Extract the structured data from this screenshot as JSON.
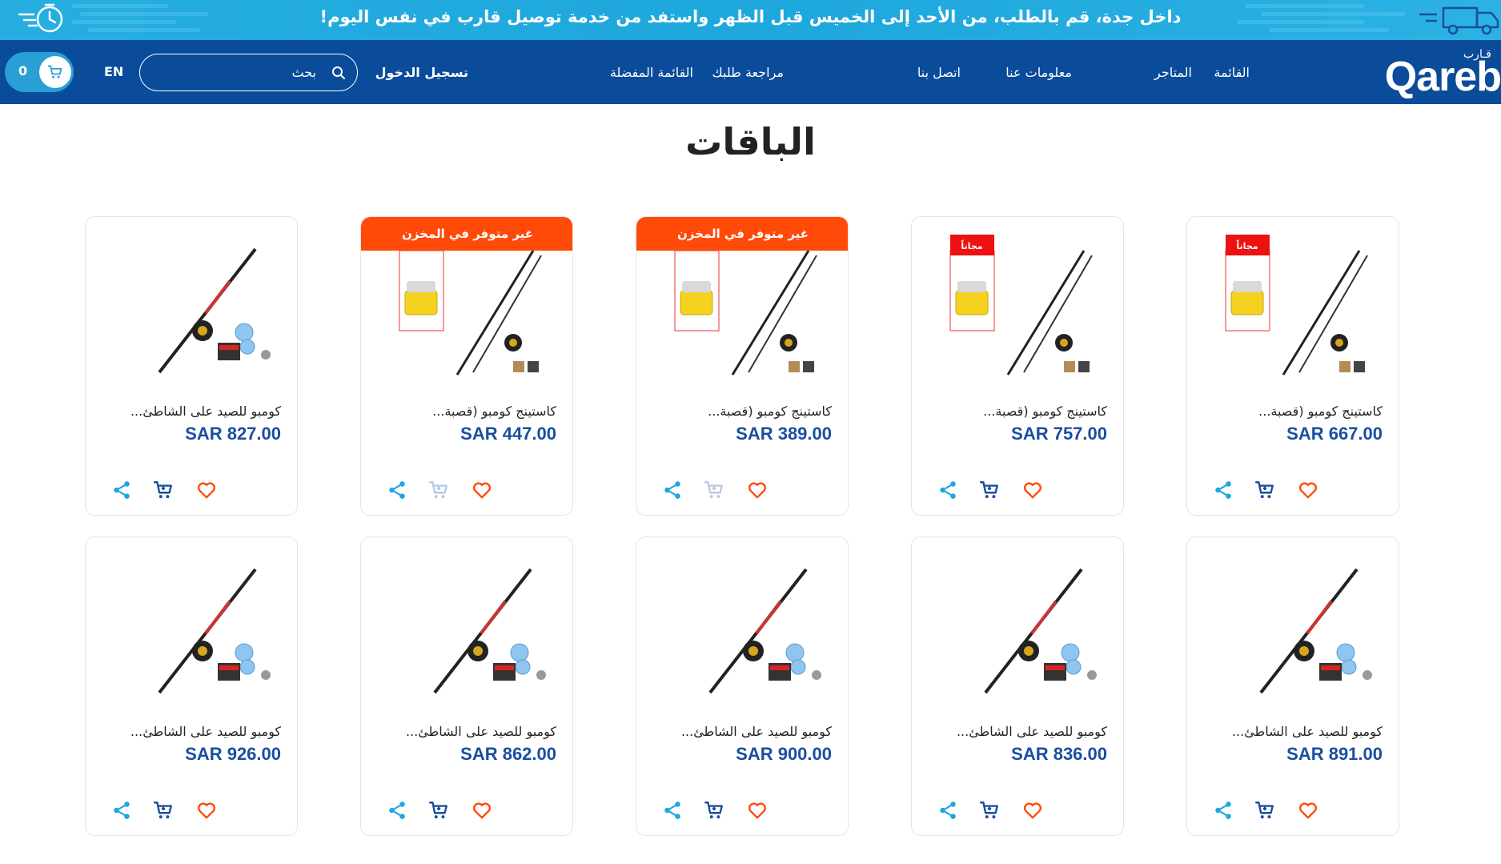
{
  "promo": {
    "text": "داخل جدة، قم بالطلب، من الأحد إلى الخميس قبل الظهر واستفد من خدمة توصيل قارب في نفس اليوم!"
  },
  "header": {
    "logo_text": "Qareb",
    "logo_arabic": "قـارب",
    "nav": {
      "menu": "القائمة",
      "stores": "المتاجر",
      "about": "معلومات عنا",
      "contact": "اتصل بنا",
      "review_order": "مراجعة طلبك",
      "wishlist": "القائمة المفضلة",
      "login": "تسجيل الدخول"
    },
    "search_placeholder": "بحث",
    "language": "EN",
    "cart_count": "0"
  },
  "page_title": "الباقات",
  "colors": {
    "header_bg": "#0a4c9a",
    "promo_bg": "#26aee0",
    "price": "#1a4ea0",
    "out_of_stock": "#ff4a0a",
    "heart": "#ff4a0a",
    "cart": "#1a4ea0",
    "share": "#1ea7dc"
  },
  "products": [
    {
      "name": "كاستينج كومبو (قصبة...",
      "price": "SAR 667.00",
      "badge": "",
      "free_tag": "مجاناً",
      "cart_enabled": true
    },
    {
      "name": "كاستينج كومبو (قصبة...",
      "price": "SAR 757.00",
      "badge": "",
      "free_tag": "مجاناً",
      "cart_enabled": true
    },
    {
      "name": "كاستينج كومبو (قصبة...",
      "price": "SAR 389.00",
      "badge": "غير متوفر في المخزن",
      "free_tag": "",
      "cart_enabled": false
    },
    {
      "name": "كاستينج كومبو (قصبة...",
      "price": "SAR 447.00",
      "badge": "غير متوفر في المخزن",
      "free_tag": "",
      "cart_enabled": false
    },
    {
      "name": "كومبو للصيد على الشاطئ...",
      "price": "SAR 827.00",
      "badge": "",
      "free_tag": "",
      "cart_enabled": true
    },
    {
      "name": "كومبو للصيد على الشاطئ...",
      "price": "SAR 891.00",
      "badge": "",
      "free_tag": "",
      "cart_enabled": true
    },
    {
      "name": "كومبو للصيد على الشاطئ...",
      "price": "SAR 836.00",
      "badge": "",
      "free_tag": "",
      "cart_enabled": true
    },
    {
      "name": "كومبو للصيد على الشاطئ...",
      "price": "SAR 900.00",
      "badge": "",
      "free_tag": "",
      "cart_enabled": true
    },
    {
      "name": "كومبو للصيد على الشاطئ...",
      "price": "SAR 862.00",
      "badge": "",
      "free_tag": "",
      "cart_enabled": true
    },
    {
      "name": "كومبو للصيد على الشاطئ...",
      "price": "SAR 926.00",
      "badge": "",
      "free_tag": "",
      "cart_enabled": true
    }
  ]
}
